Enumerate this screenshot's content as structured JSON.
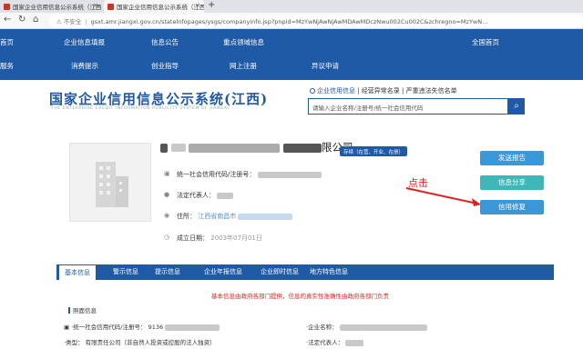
{
  "browser": {
    "tabs": [
      {
        "title": "国家企业信用信息公示系统（江西）",
        "close": "×"
      },
      {
        "title": "国家企业信用信息公示系统（江西）",
        "close": "×"
      }
    ],
    "new_tab": "+",
    "security_label": "不安全",
    "url": "gsxt.amr.jiangxi.gov.cn/statelnfopages/ysgs/companyinfo.jsp?pnpid=MzYwNjAwNjAwMDAwMDczNwu002Cu002C&zchregno=MzYwN..."
  },
  "top_nav": {
    "row1": [
      "首页",
      "企业信息填报",
      "信息公告",
      "重点领域信息",
      "全国首页"
    ],
    "row2": [
      "服务",
      "消费提示",
      "创业指导",
      "网上注册",
      "异议申请"
    ]
  },
  "logo": {
    "title": "国家企业信用信息公示系统(江西)",
    "subtitle": "THE ENTERPRISE CREDIT INFORMATION PUBLICITY SYSTEM OF JIANGXI"
  },
  "quick_links": {
    "active": "企业信用信息",
    "others": "经营异常名录 | 严重违法失信名单"
  },
  "search": {
    "placeholder": "请输入企业名称/注册号/统一社会信用代码",
    "icon": "search-icon"
  },
  "company": {
    "name_suffix": "限公司",
    "status": "存续（在营、开业、在册）",
    "credit_code_label": "统一社会信用代码/注册号：",
    "legal_rep_label": "法定代表人：",
    "address_label": "住所：",
    "address_value": "江西省南昌市",
    "established_label": "成立日期：",
    "established_value": "2003年07月01日"
  },
  "actions": {
    "send_report": "发送报告",
    "share": "信息分享",
    "credit_repair": "信用修复"
  },
  "annotation": {
    "text": "点击",
    "color": "#e02020"
  },
  "detail_tabs": [
    "基本信息",
    "警示信息",
    "提示信息",
    "企业年报信息",
    "企业即时信息",
    "地方特色信息"
  ],
  "notice": "基本信息由政府各部门提供，信息的真实性准确性由政府各部门负责",
  "section": {
    "title": "照面信息",
    "fields": {
      "credit_code_label": "·统一社会信用代码/注册号：",
      "credit_code_value": "9136",
      "type_label": "·类型：",
      "type_value": "有限责任公司（非自然人投资或控股的法人独资）",
      "company_name_label": "·企业名称：",
      "legal_rep_label": "·法定代表人："
    }
  },
  "colors": {
    "brand": "#1f5aa6",
    "button_blue": "#3c97d6",
    "button_teal": "#3fb6b8",
    "alert_red": "#e02020"
  }
}
